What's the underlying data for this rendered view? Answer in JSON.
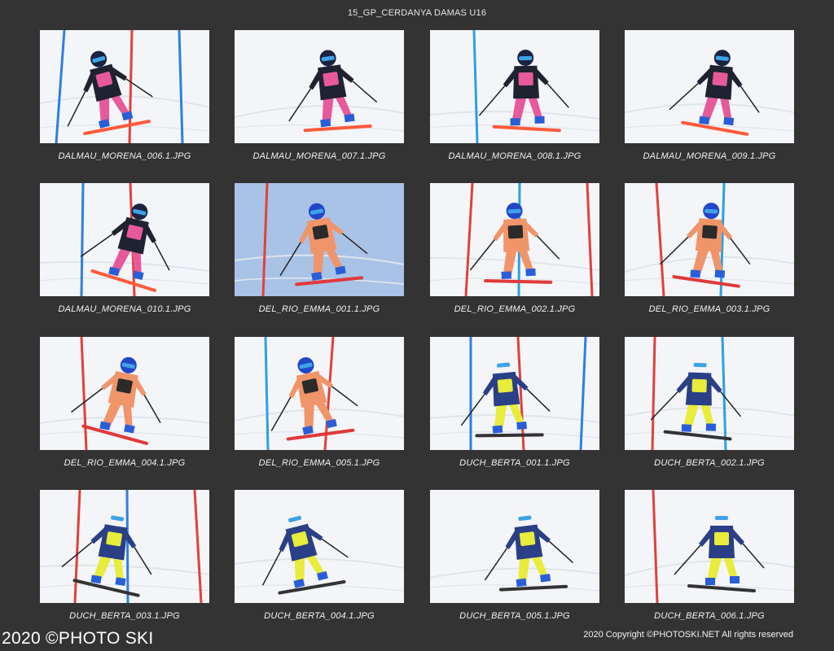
{
  "header": {
    "title": "15_GP_CERDANYA DAMAS U16"
  },
  "gallery": {
    "items": [
      {
        "caption": "DALMAU_MORENA_006.1.JPG",
        "suit": "dalmau",
        "bg": "snow",
        "poles": [
          "#2f7fe0",
          "#e0413a",
          "#2f7fe0"
        ],
        "skis": "#ff5a3a"
      },
      {
        "caption": "DALMAU_MORENA_007.1.JPG",
        "suit": "dalmau",
        "bg": "snow",
        "poles": [],
        "skis": "#ff5a3a"
      },
      {
        "caption": "DALMAU_MORENA_008.1.JPG",
        "suit": "dalmau",
        "bg": "snow",
        "poles": [
          "#2f9fe0"
        ],
        "skis": "#ff5a3a"
      },
      {
        "caption": "DALMAU_MORENA_009.1.JPG",
        "suit": "dalmau",
        "bg": "snow",
        "poles": [],
        "skis": "#ff5a3a"
      },
      {
        "caption": "DALMAU_MORENA_010.1.JPG",
        "suit": "dalmau",
        "bg": "snow",
        "poles": [
          "#2f7fe0",
          "#e0413a"
        ],
        "skis": "#ff5a3a"
      },
      {
        "caption": "DEL_RIO_EMMA_001.1.JPG",
        "suit": "delrio",
        "bg": "bluesnow",
        "poles": [
          "#e0413a"
        ],
        "skis": "#e03a3a"
      },
      {
        "caption": "DEL_RIO_EMMA_002.1.JPG",
        "suit": "delrio",
        "bg": "snow",
        "poles": [
          "#e0413a",
          "#2f9fe0",
          "#e0413a"
        ],
        "skis": "#e03a3a"
      },
      {
        "caption": "DEL_RIO_EMMA_003.1.JPG",
        "suit": "delrio",
        "bg": "snow",
        "poles": [
          "#e0413a",
          "#2f9fe0"
        ],
        "skis": "#e03a3a"
      },
      {
        "caption": "DEL_RIO_EMMA_004.1.JPG",
        "suit": "delrio",
        "bg": "snow",
        "poles": [
          "#e0413a"
        ],
        "skis": "#e03a3a"
      },
      {
        "caption": "DEL_RIO_EMMA_005.1.JPG",
        "suit": "delrio",
        "bg": "snow",
        "poles": [
          "#2f9fe0",
          "#e0413a"
        ],
        "skis": "#e03a3a"
      },
      {
        "caption": "DUCH_BERTA_001.1.JPG",
        "suit": "duch",
        "bg": "snow",
        "poles": [
          "#2f7fe0",
          "#e0413a",
          "#2f7fe0"
        ],
        "skis": "#333333"
      },
      {
        "caption": "DUCH_BERTA_002.1.JPG",
        "suit": "duch",
        "bg": "snow",
        "poles": [
          "#e0413a",
          "#2f9fe0"
        ],
        "skis": "#333333"
      },
      {
        "caption": "DUCH_BERTA_003.1.JPG",
        "suit": "duch",
        "bg": "snow",
        "poles": [
          "#e0413a",
          "#2f7fe0",
          "#e0413a"
        ],
        "skis": "#333333"
      },
      {
        "caption": "DUCH_BERTA_004.1.JPG",
        "suit": "duch",
        "bg": "snow",
        "poles": [],
        "skis": "#333333"
      },
      {
        "caption": "DUCH_BERTA_005.1.JPG",
        "suit": "duch",
        "bg": "snow",
        "poles": [],
        "skis": "#333333"
      },
      {
        "caption": "DUCH_BERTA_006.1.JPG",
        "suit": "duch",
        "bg": "snow",
        "poles": [
          "#e0413a"
        ],
        "skis": "#333333"
      }
    ]
  },
  "footer": {
    "watermark": "2020 ©PHOTO SKI",
    "copyright": "2020 Copyright ©PHOTOSKI.NET All rights reserved"
  },
  "colors": {
    "background": "#333333",
    "snow": "#f3f5f8",
    "blue_snow": "#a9c3e6",
    "dalmau_suit": "#1f2230",
    "dalmau_accent": "#e65a9a",
    "delrio_suit": "#f0956a",
    "delrio_accent": "#2a2a2a",
    "duch_suit": "#2b3f86",
    "duch_accent": "#e8ec3a"
  }
}
